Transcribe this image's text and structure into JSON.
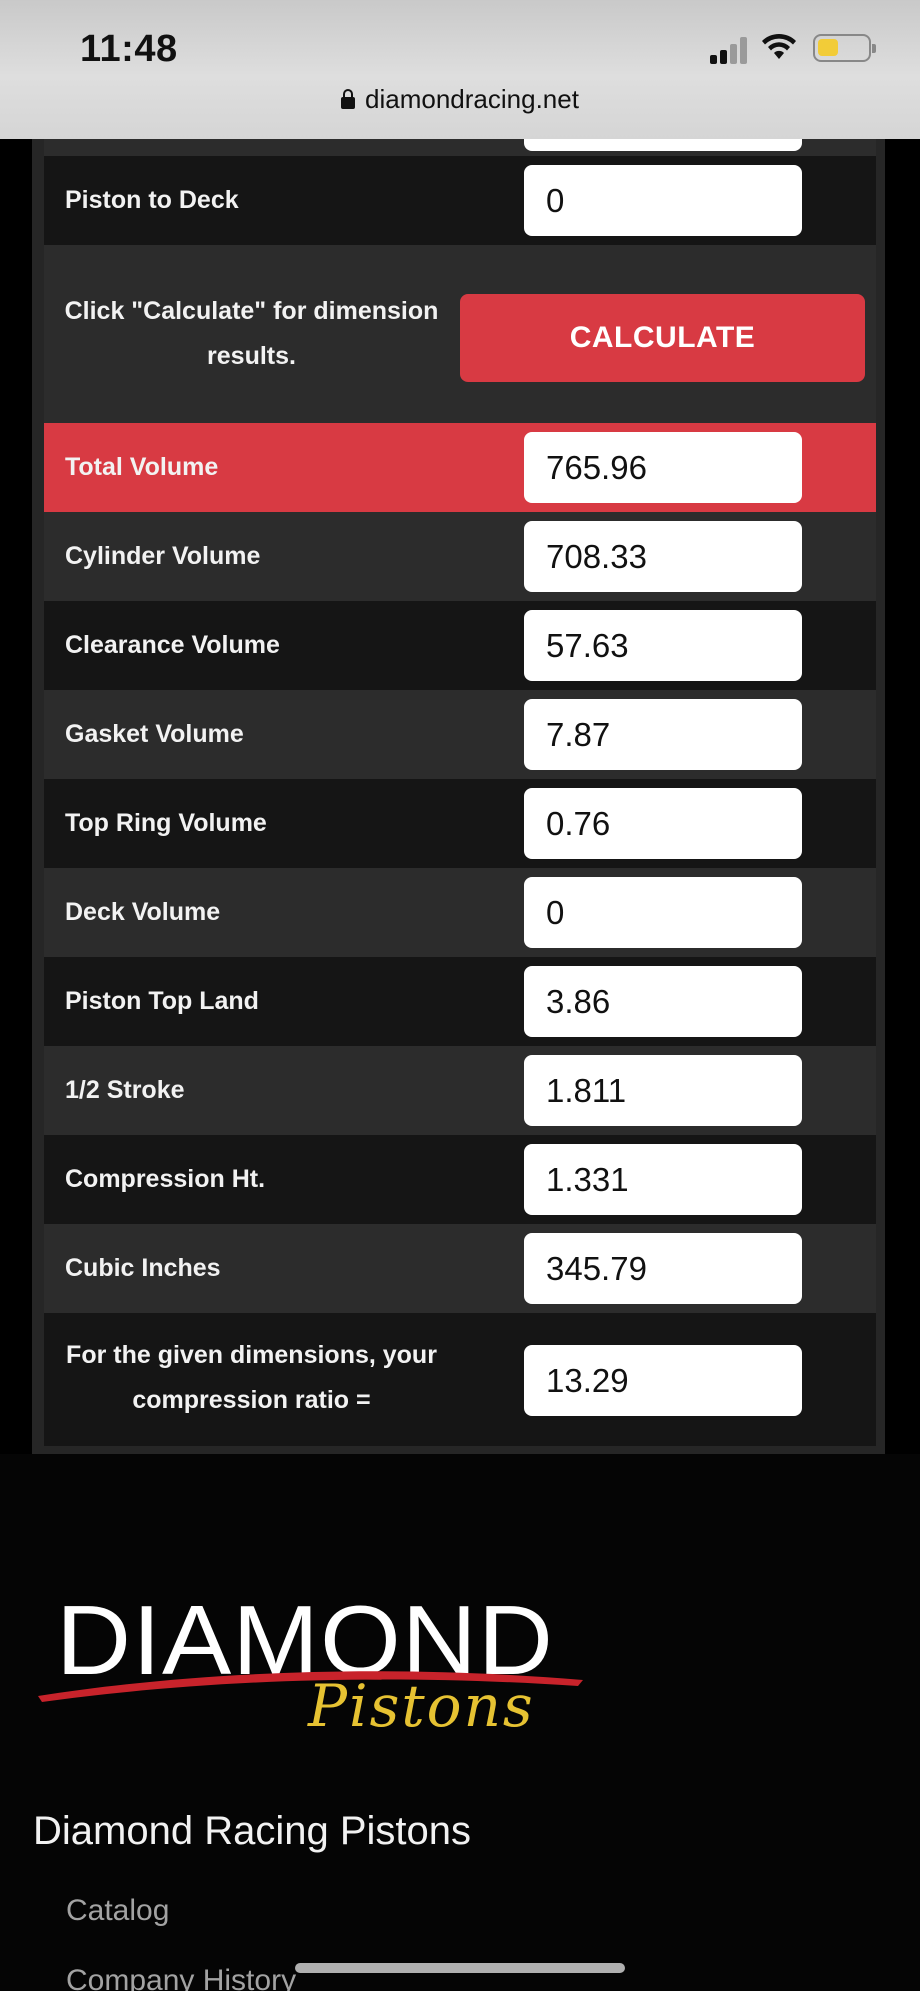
{
  "status_bar": {
    "time": "11:48",
    "url": "diamondracing.net"
  },
  "calculator": {
    "piston_to_deck": {
      "label": "Piston to Deck",
      "value": "0"
    },
    "calc_prompt": "Click \"Calculate\" for dimension results.",
    "calculate_label": "CALCULATE",
    "results": [
      {
        "label": "Total Volume",
        "value": "765.96"
      },
      {
        "label": "Cylinder Volume",
        "value": "708.33"
      },
      {
        "label": "Clearance Volume",
        "value": "57.63"
      },
      {
        "label": "Gasket Volume",
        "value": "7.87"
      },
      {
        "label": "Top Ring Volume",
        "value": "0.76"
      },
      {
        "label": "Deck Volume",
        "value": "0"
      },
      {
        "label": "Piston Top Land",
        "value": "3.86"
      },
      {
        "label": "1/2 Stroke",
        "value": "1.811"
      },
      {
        "label": "Compression Ht.",
        "value": "1.331"
      },
      {
        "label": "Cubic Inches",
        "value": "345.79"
      }
    ],
    "ratio_label": "For the given dimensions, your compression ratio =",
    "ratio_value": "13.29"
  },
  "footer": {
    "logo_text": "DIAMOND",
    "logo_sub": "Pistons",
    "title": "Diamond Racing Pistons",
    "links": [
      "Catalog",
      "Company History"
    ]
  },
  "colors": {
    "accent_red": "#d83a43",
    "logo_gold": "#e6c232",
    "panel_dark": "#151515",
    "panel_mid": "#2c2c2c"
  }
}
